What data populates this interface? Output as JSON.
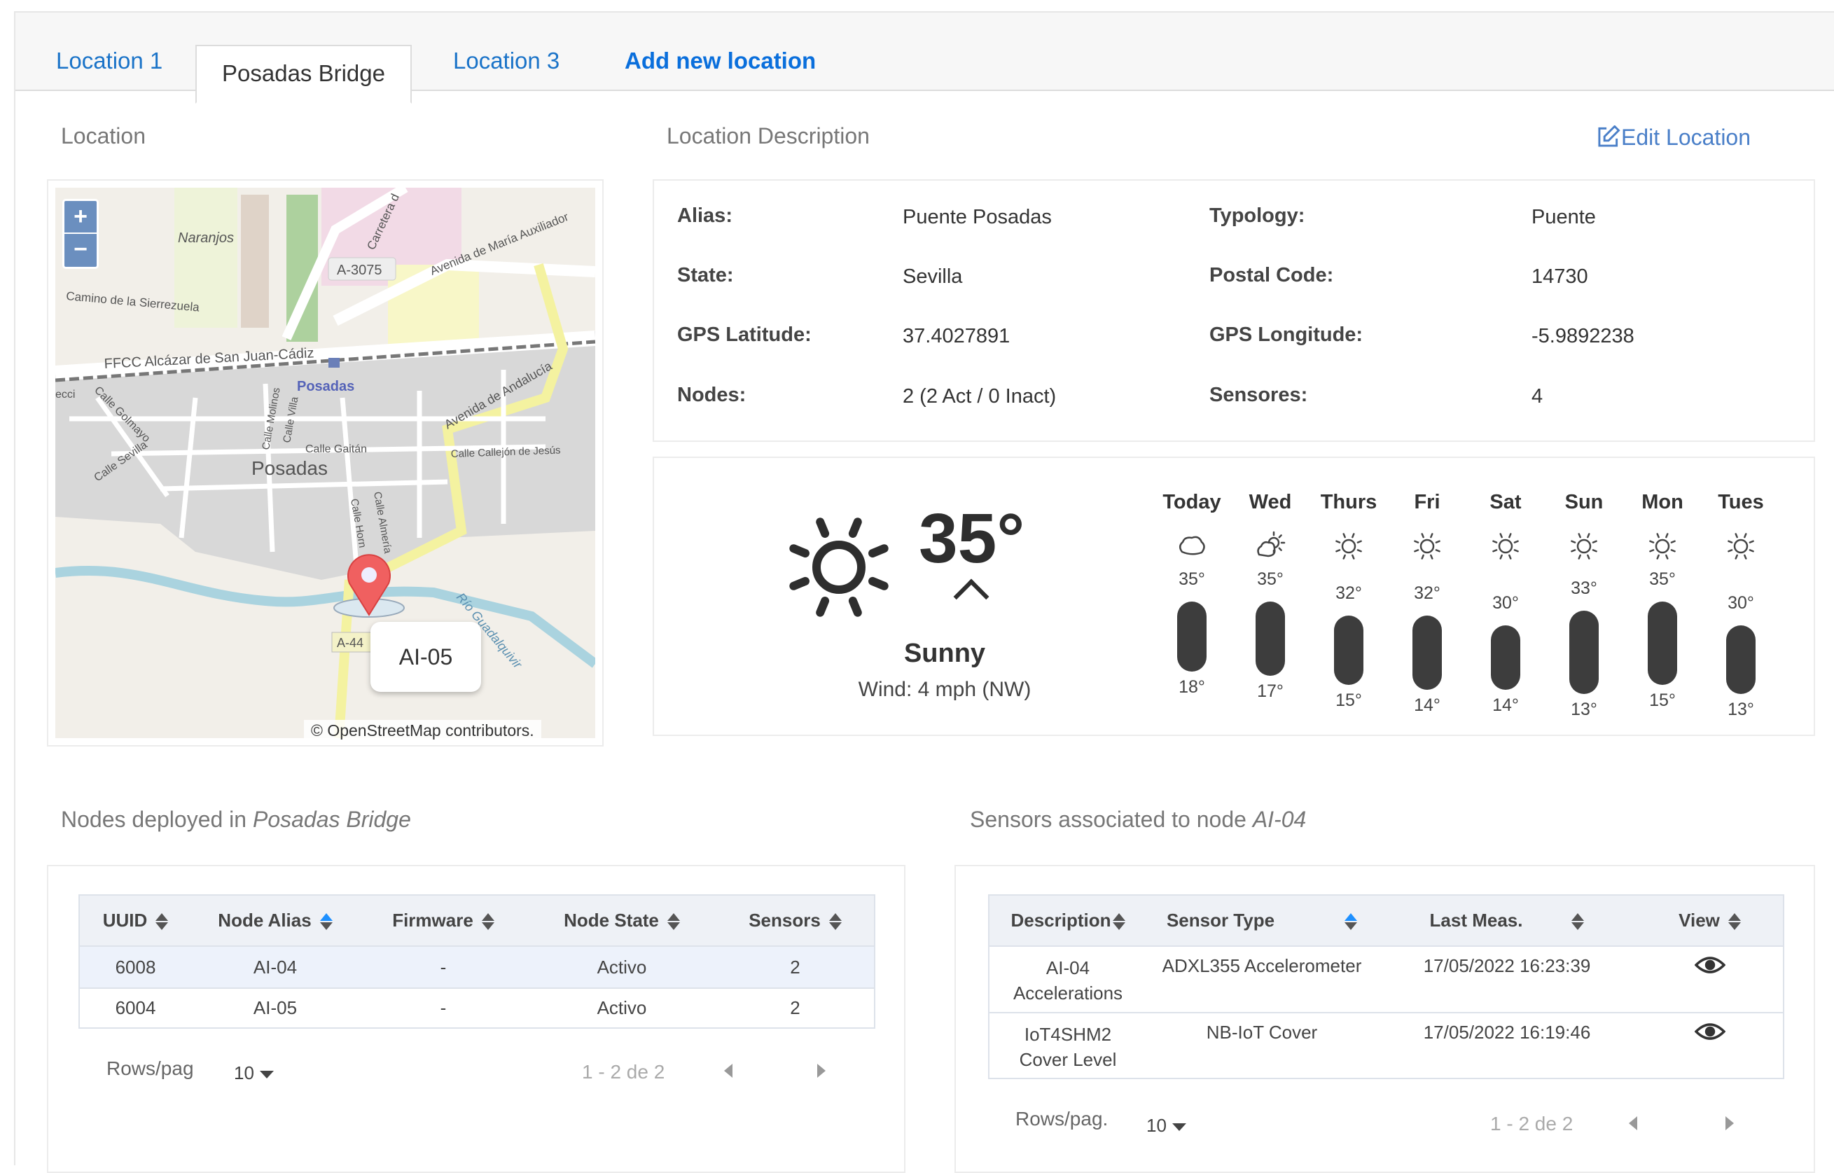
{
  "tabs": [
    {
      "label": "Location 1"
    },
    {
      "label": "Posadas Bridge"
    },
    {
      "label": "Location 3"
    },
    {
      "label": "Add new location"
    }
  ],
  "location": {
    "heading": "Location",
    "map": {
      "labels": {
        "naranjos": "Naranjos",
        "a3075": "A-3075",
        "camino": "Camino de la Sierrezuela",
        "carretera": "Carretera d",
        "maria": "Avenida de María Auxiliador",
        "ffcc": "FFCC Alcázar de San Juan-Cádiz",
        "posadas_station": "Posadas",
        "golmayo": "Calle Golmayo",
        "sevilla": "Calle Sevilla",
        "molinos": "Calle Molinos",
        "villa": "Calle Villa",
        "gaitan": "Calle Gaitán",
        "posadas_town": "Posadas",
        "andalucia": "Avenida de Andalucía",
        "callejon": "Calle Callejón de Jesús",
        "hornos": "Calle Horn",
        "almeria": "Calle Almería",
        "guadalquivir": "Río Guadalquivir",
        "a44": "A-44",
        "ecci": "ecci"
      },
      "zoom_in": "+",
      "zoom_out": "−",
      "popup": "AI-05",
      "attribution": "© OpenStreetMap contributors."
    }
  },
  "description": {
    "heading": "Location Description",
    "edit_label": "Edit Location",
    "fields": [
      {
        "label": "Alias:",
        "value": "Puente Posadas"
      },
      {
        "label": "Typology:",
        "value": "Puente"
      },
      {
        "label": "State:",
        "value": "Sevilla"
      },
      {
        "label": "Postal Code:",
        "value": "14730"
      },
      {
        "label": "GPS Latitude:",
        "value": "37.4027891"
      },
      {
        "label": "GPS Longitude:",
        "value": "-5.9892238"
      },
      {
        "label": "Nodes:",
        "value": "2 (2 Act / 0 Inact)"
      },
      {
        "label": "Sensores:",
        "value": "4"
      }
    ]
  },
  "weather": {
    "current_temp": "35°",
    "condition": "Sunny",
    "wind": "Wind: 4 mph (NW)",
    "forecast": [
      {
        "day": "Today",
        "icon": "cloud",
        "high": 35,
        "low": 18,
        "high_label": "35°",
        "low_label": "18°"
      },
      {
        "day": "Wed",
        "icon": "partly-cloudy",
        "high": 35,
        "low": 17,
        "high_label": "35°",
        "low_label": "17°"
      },
      {
        "day": "Thurs",
        "icon": "sun",
        "high": 32,
        "low": 15,
        "high_label": "32°",
        "low_label": "15°"
      },
      {
        "day": "Fri",
        "icon": "sun",
        "high": 32,
        "low": 14,
        "high_label": "32°",
        "low_label": "14°"
      },
      {
        "day": "Sat",
        "icon": "sun",
        "high": 30,
        "low": 14,
        "high_label": "30°",
        "low_label": "14°"
      },
      {
        "day": "Sun",
        "icon": "sun",
        "high": 33,
        "low": 13,
        "high_label": "33°",
        "low_label": "13°"
      },
      {
        "day": "Mon",
        "icon": "sun",
        "high": 35,
        "low": 15,
        "high_label": "35°",
        "low_label": "15°"
      },
      {
        "day": "Tues",
        "icon": "sun",
        "high": 30,
        "low": 13,
        "high_label": "30°",
        "low_label": "13°"
      }
    ]
  },
  "nodes": {
    "heading_prefix": "Nodes deployed in ",
    "heading_location": "Posadas Bridge",
    "columns": [
      "UUID",
      "Node Alias",
      "Firmware",
      "Node State",
      "Sensors"
    ],
    "rows": [
      [
        "6008",
        "AI-04",
        "-",
        "Activo",
        "2"
      ],
      [
        "6004",
        "AI-05",
        "-",
        "Activo",
        "2"
      ]
    ],
    "rows_label": "Rows/pag",
    "rows_value": "10",
    "range": "1 - 2 de 2"
  },
  "sensors": {
    "heading_prefix": "Sensors associated to node ",
    "heading_node": "AI-04",
    "columns": [
      "Description",
      "Sensor Type",
      "Last Meas.",
      "View"
    ],
    "rows": [
      [
        "AI-04",
        "Accelerations",
        "ADXL355 Accelerometer",
        "17/05/2022 16:23:39"
      ],
      [
        "IoT4SHM2",
        "Cover Level",
        "NB-IoT Cover",
        "17/05/2022 16:19:46"
      ]
    ],
    "rows_label": "Rows/pag.",
    "rows_value": "10",
    "range": "1 - 2 de 2"
  }
}
